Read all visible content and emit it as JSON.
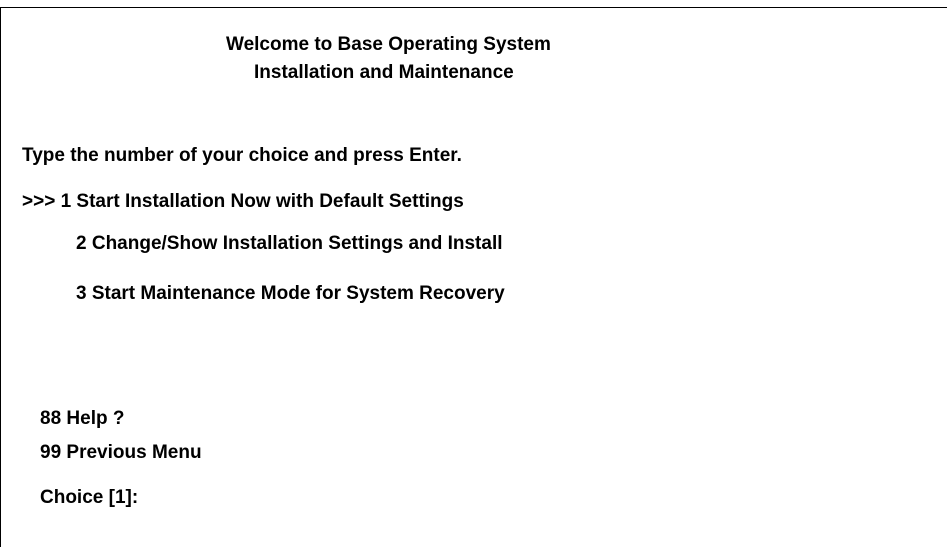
{
  "header": {
    "title_line1": "Welcome to Base Operating System",
    "title_line2": "Installation and Maintenance"
  },
  "instructions": "Type the number of your choice and press Enter.",
  "selection_marker": ">>> ",
  "menu": {
    "options": [
      {
        "label": "1 Start Installation Now with Default Settings",
        "selected": true
      },
      {
        "label": "2 Change/Show Installation Settings and Install",
        "selected": false
      },
      {
        "label": "3 Start Maintenance Mode for System Recovery",
        "selected": false
      }
    ]
  },
  "footer": {
    "help": "88 Help ?",
    "previous": "99 Previous Menu",
    "choice_prompt": "Choice [1]:"
  },
  "colors": {
    "background": "#ffffff",
    "text": "#000000"
  }
}
